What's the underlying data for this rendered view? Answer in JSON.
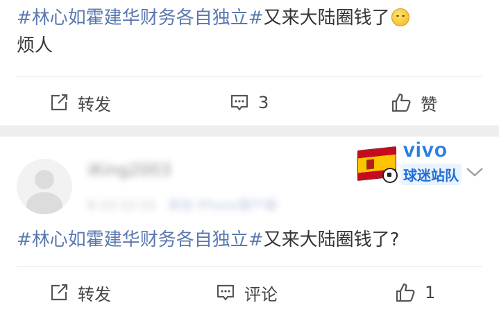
{
  "post1": {
    "topic": "#林心如霍建华财务各自独立#",
    "text_line1": "又来大陆圈钱了",
    "emoji": "shush-face-emoji",
    "text_line2": "烦人",
    "actions": {
      "repost": "转发",
      "comment_count": "3",
      "like": "赞"
    }
  },
  "post2": {
    "topic": "#林心如霍建华财务各自独立#",
    "text": "又来大陆圈钱了?",
    "actions": {
      "repost": "转发",
      "comment": "评论",
      "like_count": "1"
    }
  },
  "author": {
    "name": "iKing2003",
    "meta": "6-13  12:15",
    "meta_link": "来自 iPhone客户端"
  },
  "badge": {
    "brand": "vivo",
    "team": "球迷站队",
    "flag": "spain-flag-icon"
  },
  "colors": {
    "topic": "#5b78b0",
    "brand": "#2b7de3",
    "divider": "#eeeeee",
    "icon": "#555555"
  }
}
